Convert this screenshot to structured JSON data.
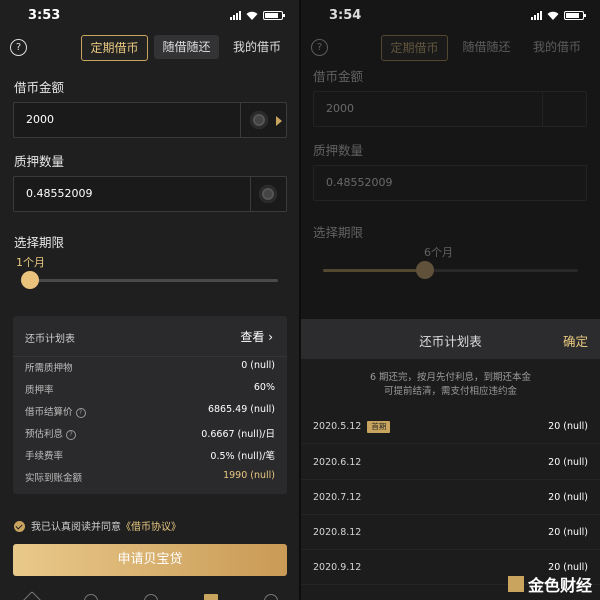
{
  "left": {
    "status_time": "3:53",
    "tabs": [
      "定期借币",
      "随借随还",
      "我的借币"
    ],
    "borrow_label": "借币金额",
    "borrow_value": "2000",
    "collateral_label": "质押数量",
    "collateral_value": "0.48552009",
    "term_label": "选择期限",
    "term_value": "1个月",
    "term_fraction": 0.0,
    "plan": {
      "title": "还币计划表",
      "view": "查看 ›",
      "rows": [
        {
          "k": "所需质押物",
          "v": "0 (null)"
        },
        {
          "k": "质押率",
          "v": "60%"
        },
        {
          "k": "借币结算价",
          "v": "6865.49 (null)"
        },
        {
          "k": "预估利息",
          "v": "0.6667 (null)/日"
        },
        {
          "k": "手续费率",
          "v": "0.5% (null)/笔"
        },
        {
          "k": "实际到账金额",
          "v": "1990 (null)"
        }
      ]
    },
    "agree_prefix": "我已认真阅读并同意",
    "agree_link": "《借币协议》",
    "apply_button": "申请贝宝贷"
  },
  "right": {
    "status_time": "3:54",
    "tabs": [
      "定期借币",
      "随借随还",
      "我的借币"
    ],
    "borrow_label": "借币金额",
    "borrow_value": "2000",
    "collateral_label": "质押数量",
    "collateral_value": "0.48552009",
    "term_label": "选择期限",
    "term_value": "6个月",
    "term_fraction": 0.4,
    "sheet": {
      "title": "还币计划表",
      "confirm": "确定",
      "note_line1": "6 期还完，按月先付利息，到期还本金",
      "note_line2": "可提前结清，需支付相应违约金",
      "first_badge": "首期",
      "rows": [
        {
          "date": "2020.5.12",
          "amount": "20 (null)"
        },
        {
          "date": "2020.6.12",
          "amount": "20 (null)"
        },
        {
          "date": "2020.7.12",
          "amount": "20 (null)"
        },
        {
          "date": "2020.8.12",
          "amount": "20 (null)"
        },
        {
          "date": "2020.9.12",
          "amount": "20 (null)"
        }
      ]
    },
    "watermark": "金色财经"
  },
  "colors": {
    "accent": "#c9a45e",
    "background": "#1f1f20"
  }
}
